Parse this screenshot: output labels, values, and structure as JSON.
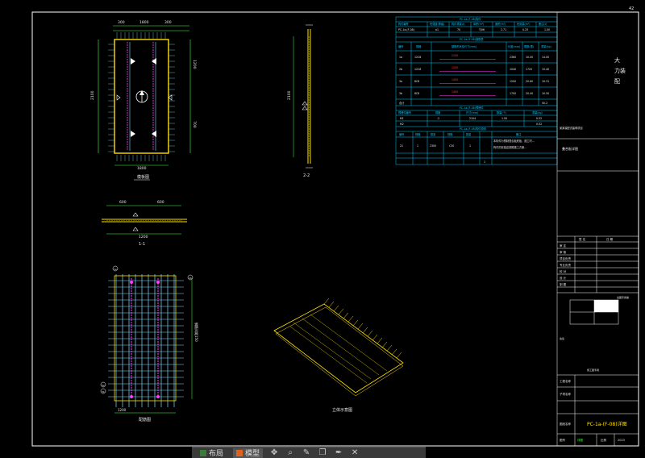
{
  "page_number": "42",
  "views": {
    "plan_label": "模板图",
    "section_1_label": "1-1",
    "section_2_label": "2-2",
    "rebar_label": "配筋图",
    "iso_label": "立体示意图"
  },
  "dims": {
    "top": [
      "300",
      "1800",
      "300"
    ],
    "left": "2100",
    "right_a": "1200",
    "right_b": "700",
    "bottom": "1800",
    "sec2_height": "2100",
    "sec1_a": "600",
    "sec1_b": "600",
    "sec1_total": "1200",
    "rebar_right": "钢筋间距150",
    "rebar_bottom": "1200"
  },
  "rebar_tags": [
    "1a",
    "2b",
    "3a",
    "3b"
  ],
  "table1": {
    "title": "PC-1a-(F-08)构件",
    "headers": [
      "构件编号",
      "砼强度(等级)",
      "构件重量(t)",
      "体积(m³)",
      "面积(m²)",
      "砼用量(m³)",
      "备注(t)"
    ],
    "row": [
      "PC-1a-(F-08)",
      "a1",
      "70",
      "TJ06",
      "2.71",
      "0.25",
      "1.00"
    ]
  },
  "table2": {
    "title": "PC-1a-(F-08)钢筋表",
    "headers": [
      "编号",
      "规格",
      "钢筋形状及尺寸(mm)",
      "长度(mm)",
      "根数(根)",
      "重量(kg)"
    ],
    "rows": [
      [
        "1a",
        "12C8",
        "2100",
        "2360",
        "10.00",
        "14.00"
      ],
      [
        "2b",
        "12C8",
        "1200",
        "1040",
        "1720",
        "15.40"
      ],
      [
        "3a",
        "8C8",
        "1400",
        "1200",
        "20.60",
        "10.31"
      ],
      [
        "3b",
        "8C8",
        "1400",
        "1700",
        "20.40",
        "10.50"
      ],
      [
        "合计",
        "",
        "",
        "",
        "",
        "50.2"
      ]
    ]
  },
  "table3": {
    "title": "PC-1a-(F-08)预埋件",
    "headers": [
      "预埋件编号",
      "规格",
      "尺寸(mm)",
      "数量(个)",
      "重量(kg)"
    ],
    "rows": [
      [
        "M1",
        "-2",
        "2104",
        "1.50",
        "0.52"
      ],
      [
        "M2",
        "",
        "",
        "",
        "0.52"
      ]
    ]
  },
  "table4": {
    "title": "PC-1a-(F-08)构件说明",
    "headers": [
      "编号",
      "规格",
      "数量",
      "规格",
      "数量",
      "备注"
    ],
    "rows": [
      [
        "21",
        "1",
        "2300",
        "C30",
        "1",
        "本构件为预制叠合板底板，施工时..."
      ],
      [
        "",
        "",
        "",
        "",
        "",
        "构件的安装应按照施工方案..."
      ]
    ],
    "sum": "1"
  },
  "titleblock": {
    "company_line1": "大",
    "company_line2": "力装",
    "company_line3": "配",
    "project_note": "某某装配式建筑项目",
    "drawing_title": "叠合板详图",
    "rows_left": [
      "审 定",
      "审 核",
      "项目负责",
      "专业负责",
      "校 对",
      "设 计",
      "制 图"
    ],
    "sig_head_left": "签 名",
    "sig_head_right": "日 期",
    "stamp_text": "出图专用章",
    "stamp_mid": "会签",
    "stamp_seal": "施工图专用",
    "project_label": "工程名称",
    "item_label": "子项名称",
    "name_label": "图纸名称",
    "drawing_name": "PC-1a-(F-08)详图",
    "drawing_no_label": "图号",
    "scale_label": "比例",
    "scale_value": "详图",
    "date_value": "2023"
  },
  "taskbar": {
    "layout_label": "布局",
    "model_label": "模型"
  },
  "colors": {
    "frame": "#ffffff",
    "table": "#00c8ff",
    "rebar": "#7fd8ff",
    "outline": "#ffe000",
    "dim": "#44ff44",
    "marker": "#ff3b3b",
    "line": "#ff3bff"
  }
}
